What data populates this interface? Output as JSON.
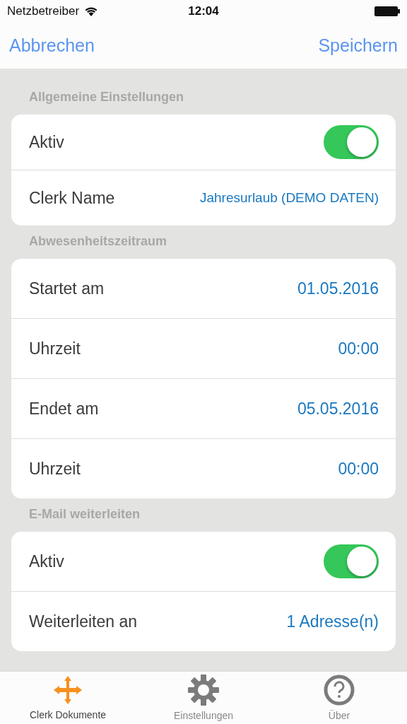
{
  "status_bar": {
    "carrier": "Netzbetreiber",
    "time": "12:04"
  },
  "nav": {
    "left": "Abbrechen",
    "right": "Speichern"
  },
  "sections": [
    {
      "title": "Allgemeine Einstellungen",
      "compact": true,
      "rows": [
        {
          "kind": "toggle",
          "label": "Aktiv",
          "on": true
        },
        {
          "kind": "value",
          "label": "Clerk Name",
          "value": "Jahresurlaub (DEMO DATEN)",
          "small": true
        }
      ]
    },
    {
      "title": "Abwesenheitszeitraum",
      "rows": [
        {
          "kind": "value",
          "label": "Startet am",
          "value": "01.05.2016"
        },
        {
          "kind": "value",
          "label": "Uhrzeit",
          "value": "00:00"
        },
        {
          "kind": "value",
          "label": "Endet am",
          "value": "05.05.2016"
        },
        {
          "kind": "value",
          "label": "Uhrzeit",
          "value": "00:00"
        }
      ]
    },
    {
      "title": "E-Mail weiterleiten",
      "rows": [
        {
          "kind": "toggle",
          "label": "Aktiv",
          "on": true
        },
        {
          "kind": "value",
          "label": "Weiterleiten an",
          "value": "1 Adresse(n)"
        }
      ]
    }
  ],
  "tabs": [
    {
      "kind": "move",
      "label": "Clerk Dokumente",
      "selected": true
    },
    {
      "kind": "gear",
      "label": "Einstellungen",
      "selected": false
    },
    {
      "kind": "help",
      "label": "Über",
      "selected": false
    }
  ]
}
